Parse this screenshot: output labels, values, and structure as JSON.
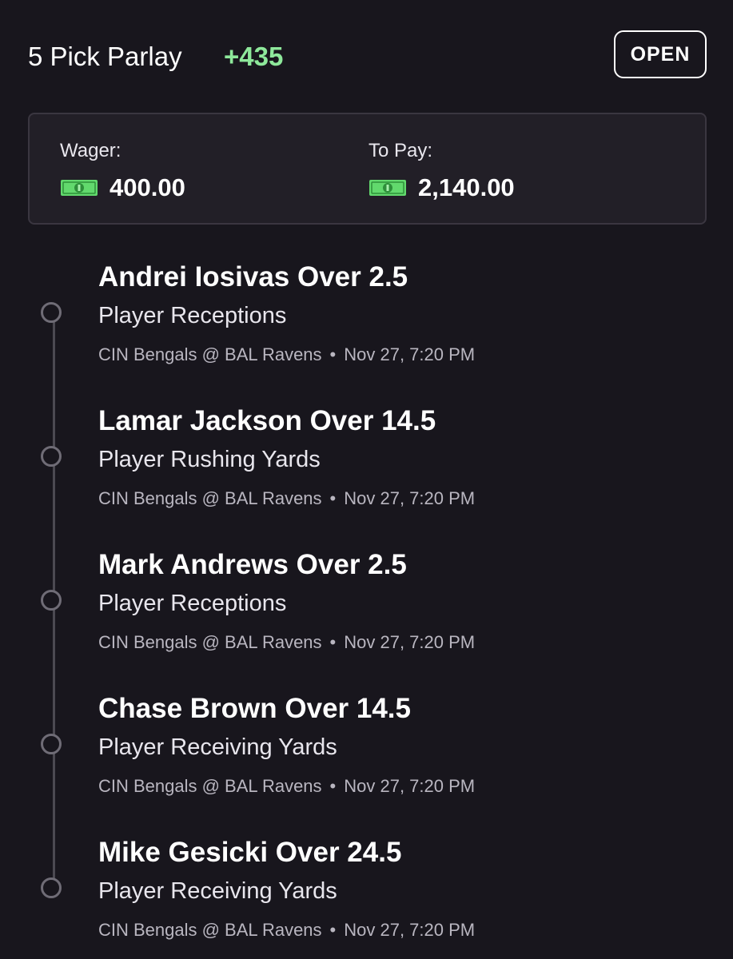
{
  "header": {
    "title": "5 Pick Parlay",
    "odds": "+435",
    "open_label": "OPEN"
  },
  "summary": {
    "wager_label": "Wager:",
    "wager_amount": "400.00",
    "to_pay_label": "To Pay:",
    "to_pay_amount": "2,140.00",
    "currency_icon": "cash-icon"
  },
  "picks": [
    {
      "title": "Andrei Iosivas Over 2.5",
      "market": "Player Receptions",
      "matchup": "CIN Bengals @ BAL Ravens",
      "separator": "•",
      "time": "Nov 27, 7:20 PM"
    },
    {
      "title": "Lamar Jackson Over 14.5",
      "market": "Player Rushing Yards",
      "matchup": "CIN Bengals @ BAL Ravens",
      "separator": "•",
      "time": "Nov 27, 7:20 PM"
    },
    {
      "title": "Mark Andrews Over 2.5",
      "market": "Player Receptions",
      "matchup": "CIN Bengals @ BAL Ravens",
      "separator": "•",
      "time": "Nov 27, 7:20 PM"
    },
    {
      "title": "Chase Brown Over 14.5",
      "market": "Player Receiving Yards",
      "matchup": "CIN Bengals @ BAL Ravens",
      "separator": "•",
      "time": "Nov 27, 7:20 PM"
    },
    {
      "title": "Mike Gesicki Over 24.5",
      "market": "Player Receiving Yards",
      "matchup": "CIN Bengals @ BAL Ravens",
      "separator": "•",
      "time": "Nov 27, 7:20 PM"
    }
  ],
  "colors": {
    "background": "#18161d",
    "accent_odds": "#8ee89b",
    "card_background": "#221f27",
    "timeline": "#4c4a52"
  }
}
